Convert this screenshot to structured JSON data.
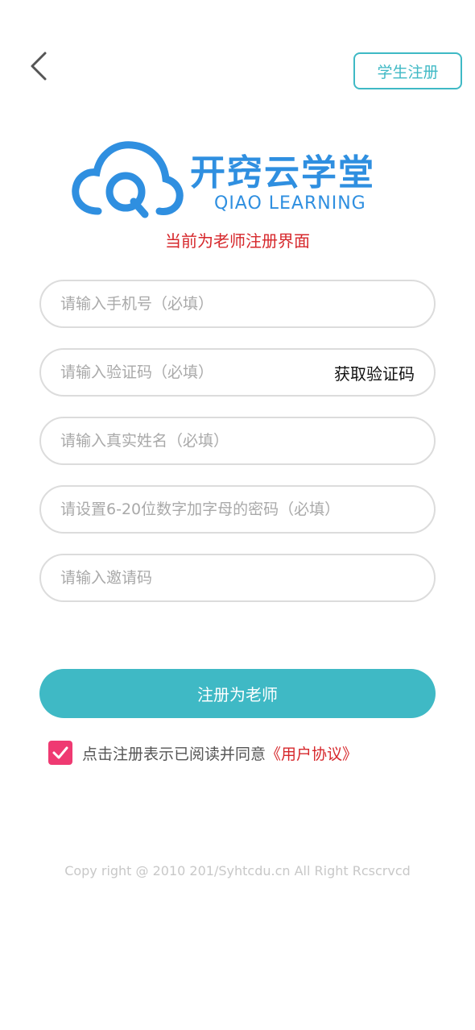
{
  "header": {
    "back_icon": "chevron-left-icon",
    "student_register_label": "学生注册"
  },
  "logo": {
    "title": "开窍云学堂",
    "subtitle": "QIAO LEARNING",
    "brand_color": "#2f8fe0"
  },
  "mode_hint": "当前为老师注册界面",
  "form": {
    "phone_placeholder": "请输入手机号（必填）",
    "code_placeholder": "请输入验证码（必填）",
    "get_code_label": "获取验证码",
    "name_placeholder": "请输入真实姓名（必填）",
    "password_placeholder": "请设置6-20位数字加字母的密码（必填）",
    "invite_placeholder": "请输入邀请码"
  },
  "submit_label": "注册为老师",
  "agreement": {
    "checked": true,
    "text": "点击注册表示已阅读并同意",
    "link": "《用户协议》"
  },
  "copyright": "Copy right @ 2010 201/Syhtcdu.cn All Right Rcscrvcd",
  "colors": {
    "accent": "#3fb9c5",
    "hint_red": "#d6272b",
    "checkbox_pink": "#ef3a72"
  }
}
